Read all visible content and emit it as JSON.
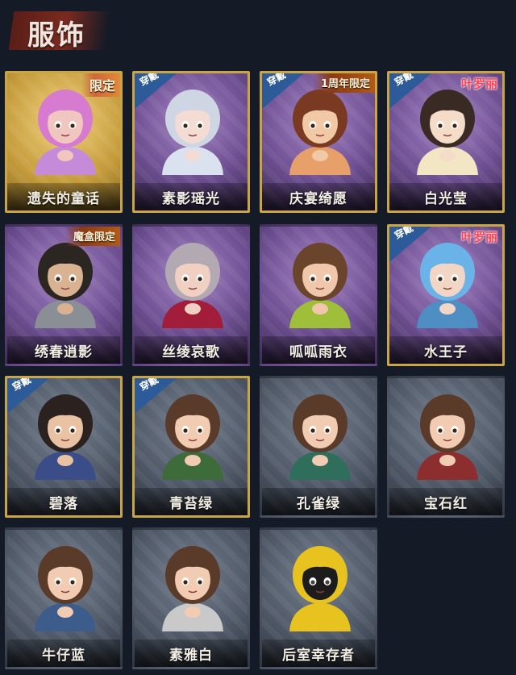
{
  "header": {
    "title": "服饰"
  },
  "badges": {
    "wearing": "穿戴"
  },
  "costumes": [
    {
      "name": "遗失的童话",
      "rarity": "gold",
      "tag": "限定",
      "tag_style": "limited",
      "wearing": false,
      "framed": true,
      "hair": "#d67bd0",
      "skin": "#f2c6c0",
      "cloth": "#c58ad8"
    },
    {
      "name": "素影瑶光",
      "rarity": "purple",
      "tag": "",
      "tag_style": "",
      "wearing": true,
      "framed": true,
      "hair": "#cfd6e3",
      "skin": "#f3dcd3",
      "cloth": "#d9e2ee"
    },
    {
      "name": "庆宴绮愿",
      "rarity": "purple",
      "tag": "1周年限定",
      "tag_style": "anniv",
      "wearing": true,
      "framed": true,
      "hair": "#7a3a22",
      "skin": "#f1c9a6",
      "cloth": "#e8a06a"
    },
    {
      "name": "白光莹",
      "rarity": "purple",
      "tag": "叶罗丽",
      "tag_style": "brand",
      "wearing": true,
      "framed": true,
      "hair": "#3a2a24",
      "skin": "#f4dcc9",
      "cloth": "#f3e6c4"
    },
    {
      "name": "绣春逍影",
      "rarity": "purple",
      "tag": "魔盒限定",
      "tag_style": "box",
      "wearing": false,
      "framed": false,
      "hair": "#2b2622",
      "skin": "#d9b391",
      "cloth": "#8a8f96"
    },
    {
      "name": "丝绫哀歌",
      "rarity": "purple",
      "tag": "",
      "tag_style": "",
      "wearing": false,
      "framed": false,
      "hair": "#b2a9b3",
      "skin": "#f0d0c2",
      "cloth": "#a11d3a"
    },
    {
      "name": "呱呱雨衣",
      "rarity": "purple",
      "tag": "",
      "tag_style": "",
      "wearing": false,
      "framed": false,
      "hair": "#6a452b",
      "skin": "#f0c7aa",
      "cloth": "#9fbf3a"
    },
    {
      "name": "水王子",
      "rarity": "purple",
      "tag": "叶罗丽",
      "tag_style": "brand",
      "wearing": true,
      "framed": true,
      "hair": "#6ab3e8",
      "skin": "#f1d6c6",
      "cloth": "#4e8ec2"
    },
    {
      "name": "碧落",
      "rarity": "grey",
      "tag": "",
      "tag_style": "",
      "wearing": true,
      "framed": true,
      "hair": "#2b2220",
      "skin": "#e8c2a2",
      "cloth": "#3b4d88"
    },
    {
      "name": "青苔绿",
      "rarity": "grey",
      "tag": "",
      "tag_style": "",
      "wearing": true,
      "framed": true,
      "hair": "#5a3a28",
      "skin": "#f1cbb2",
      "cloth": "#3e6b3a"
    },
    {
      "name": "孔雀绿",
      "rarity": "grey",
      "tag": "",
      "tag_style": "",
      "wearing": false,
      "framed": false,
      "hair": "#5a3a28",
      "skin": "#f1cbb2",
      "cloth": "#2f6e5a"
    },
    {
      "name": "宝石红",
      "rarity": "grey",
      "tag": "",
      "tag_style": "",
      "wearing": false,
      "framed": false,
      "hair": "#5a3a28",
      "skin": "#f1cbb2",
      "cloth": "#8c2e2e"
    },
    {
      "name": "牛仔蓝",
      "rarity": "grey",
      "tag": "",
      "tag_style": "",
      "wearing": false,
      "framed": false,
      "hair": "#5a3a28",
      "skin": "#f1cbb2",
      "cloth": "#3c5c8c"
    },
    {
      "name": "素雅白",
      "rarity": "grey",
      "tag": "",
      "tag_style": "",
      "wearing": false,
      "framed": false,
      "hair": "#5a3a28",
      "skin": "#f1cbb2",
      "cloth": "#c9c9c9"
    },
    {
      "name": "后室幸存者",
      "rarity": "grey",
      "tag": "",
      "tag_style": "",
      "wearing": false,
      "framed": false,
      "hair": "#e8c21f",
      "skin": "#1c1c1c",
      "cloth": "#e8c21f"
    }
  ]
}
